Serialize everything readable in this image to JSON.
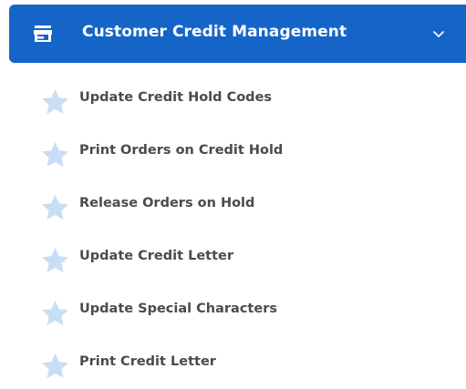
{
  "menu": {
    "header": {
      "title": "Customer Credit Management",
      "icon": "store-icon",
      "chevron_icon": "chevron-down-icon",
      "background": "#1565c8",
      "text_color": "#ffffff"
    },
    "items": [
      {
        "label": "Update Credit Hold Codes",
        "icon": "star-icon"
      },
      {
        "label": "Print Orders on Credit Hold",
        "icon": "star-icon"
      },
      {
        "label": "Release Orders on Hold",
        "icon": "star-icon"
      },
      {
        "label": "Update Credit Letter",
        "icon": "star-icon"
      },
      {
        "label": "Update Special Characters",
        "icon": "star-icon"
      },
      {
        "label": "Print Credit Letter",
        "icon": "star-icon"
      }
    ],
    "star_color": "#c8def5",
    "label_color": "#4a4a52"
  }
}
